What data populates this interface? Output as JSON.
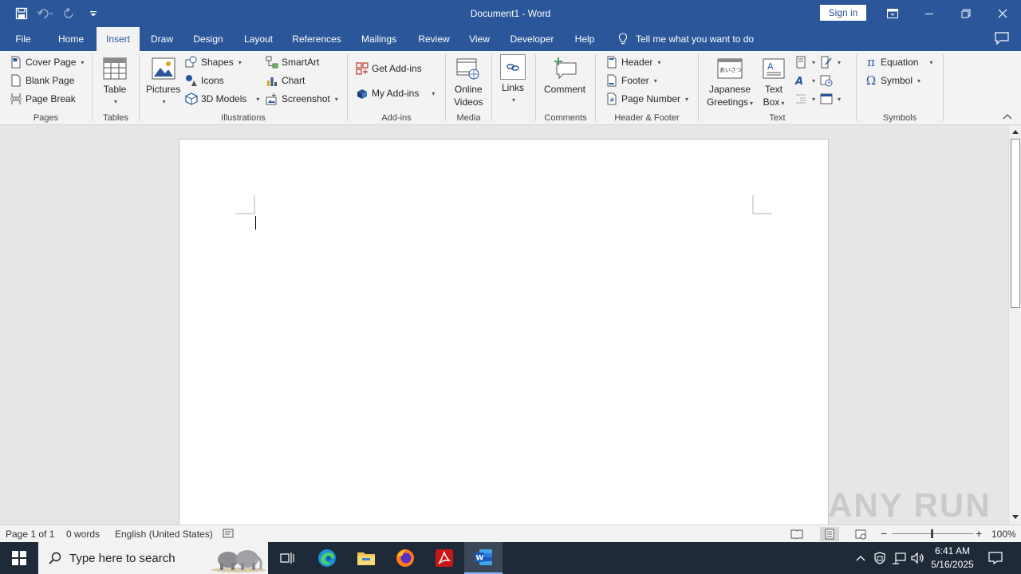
{
  "window": {
    "title": "Document1  -  Word",
    "sign_in": "Sign in"
  },
  "tabs": [
    "File",
    "Home",
    "Insert",
    "Draw",
    "Design",
    "Layout",
    "References",
    "Mailings",
    "Review",
    "View",
    "Developer",
    "Help"
  ],
  "active_tab": "Insert",
  "tell_me": "Tell me what you want to do",
  "ribbon": {
    "pages": {
      "label": "Pages",
      "items": [
        "Cover Page",
        "Blank Page",
        "Page Break"
      ]
    },
    "tables": {
      "label": "Tables",
      "table": "Table"
    },
    "illustrations": {
      "label": "Illustrations",
      "pictures": "Pictures",
      "shapes": "Shapes",
      "icons": "Icons",
      "models": "3D Models",
      "smartart": "SmartArt",
      "chart": "Chart",
      "screenshot": "Screenshot"
    },
    "addins": {
      "label": "Add-ins",
      "get": "Get Add-ins",
      "my": "My Add-ins"
    },
    "media": {
      "label": "Media",
      "online_videos_1": "Online",
      "online_videos_2": "Videos"
    },
    "links": {
      "label": "Links"
    },
    "comments": {
      "label": "Comments",
      "comment": "Comment"
    },
    "header_footer": {
      "label": "Header & Footer",
      "header": "Header",
      "footer": "Footer",
      "page_number": "Page Number"
    },
    "text": {
      "label": "Text",
      "japanese_1": "Japanese",
      "japanese_2": "Greetings",
      "japanese_icon_text": "あいさつ",
      "textbox_1": "Text",
      "textbox_2": "Box"
    },
    "symbols": {
      "label": "Symbols",
      "equation": "Equation",
      "symbol": "Symbol"
    }
  },
  "status": {
    "page": "Page 1 of 1",
    "words": "0 words",
    "language": "English (United States)",
    "zoom": "100%"
  },
  "taskbar": {
    "search_placeholder": "Type here to search",
    "time": "6:41 AM",
    "date": "5/16/2025"
  },
  "watermark": "ANY RUN",
  "colors": {
    "word_blue": "#2b579a",
    "ribbon_bg": "#f3f3f3",
    "taskbar_bg": "#1f2a38"
  }
}
